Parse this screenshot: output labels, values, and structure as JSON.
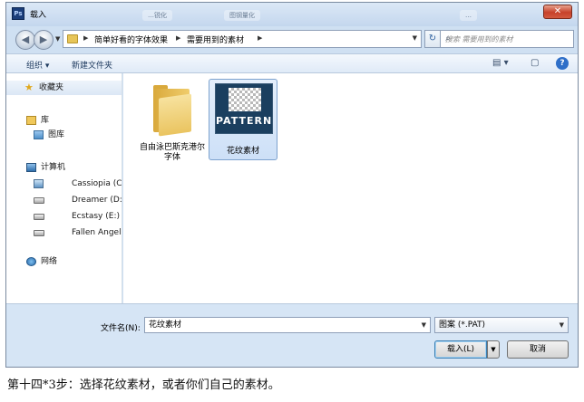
{
  "window": {
    "title": "载入",
    "app_icon": "Ps"
  },
  "ghost_tabs": [
    "…锐化",
    "图钢量化",
    "…"
  ],
  "nav": {
    "breadcrumbs": [
      "简单好看的字体效果",
      "需要用到的素材"
    ],
    "search_placeholder": "搜索 需要用到的素材"
  },
  "toolbar": {
    "organize": "组织 ▾",
    "new_folder": "新建文件夹"
  },
  "sidebar": {
    "favorites": "收藏夹",
    "library": "库",
    "pictures": "图库",
    "computer": "计算机",
    "drives": [
      "Cassiopia (C",
      "Dreamer (D:",
      "Ecstasy (E:)",
      "Fallen Angel"
    ],
    "network": "网络"
  },
  "files": [
    {
      "name": "自由泳巴斯克港尔字体",
      "type": "folder"
    },
    {
      "name": "花纹素材",
      "type": "pattern",
      "thumb_text": "PATTERN"
    }
  ],
  "footer": {
    "filename_label": "文件名(N):",
    "filename_value": "花纹素材",
    "filetype_value": "图案 (*.PAT)",
    "load_button": "载入(L)",
    "cancel_button": "取消"
  },
  "caption": "第十四*3步：选择花纹素材，或者你们自己的素材。",
  "colors": {
    "window_blue": "#cfe0f2",
    "selection": "#cde0f7",
    "pattern_bg": "#1b3f5f"
  }
}
